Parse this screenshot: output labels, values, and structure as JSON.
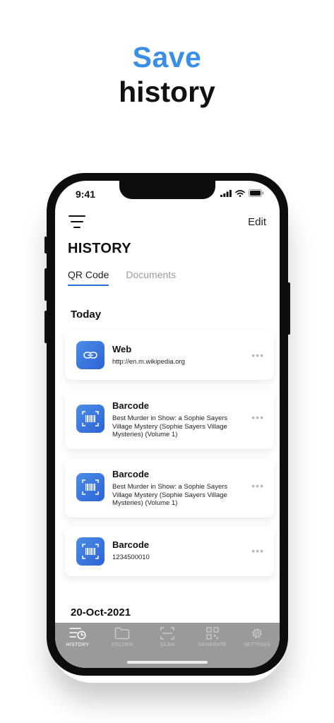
{
  "headline": {
    "accent": "Save",
    "main": "history"
  },
  "status_bar": {
    "time": "9:41"
  },
  "header": {
    "edit_label": "Edit",
    "title": "HISTORY"
  },
  "tabs": [
    {
      "label": "QR Code",
      "active": true
    },
    {
      "label": "Documents",
      "active": false
    }
  ],
  "sections": [
    {
      "title": "Today",
      "items": [
        {
          "type": "Web",
          "icon": "link-icon",
          "subtitle": "http://en.m.wikipedia.org"
        },
        {
          "type": "Barcode",
          "icon": "barcode-icon",
          "subtitle": "Best Murder in Show: a Sophie Sayers Village Mystery (Sophie Sayers Village Mysteries) (Volume 1)"
        },
        {
          "type": "Barcode",
          "icon": "barcode-icon",
          "subtitle": "Best Murder in Show: a Sophie Sayers Village Mystery (Sophie Sayers Village Mysteries) (Volume 1)"
        },
        {
          "type": "Barcode",
          "icon": "barcode-icon",
          "subtitle": "1234500010"
        }
      ]
    },
    {
      "title": "20-Oct-2021",
      "items": []
    }
  ],
  "more_glyph": "•••",
  "bottom_nav": [
    {
      "label": "HISTORY",
      "icon": "history-icon",
      "active": true
    },
    {
      "label": "FOLDER",
      "icon": "folder-icon",
      "active": false
    },
    {
      "label": "SCAN",
      "icon": "scan-icon",
      "active": false
    },
    {
      "label": "GENERATE",
      "icon": "qr-generate-icon",
      "active": false
    },
    {
      "label": "SETTINGS",
      "icon": "gear-icon",
      "active": false
    }
  ],
  "colors": {
    "accent": "#3a8ee6",
    "icon_tile": "#3a74e0",
    "tab_underline": "#2f6fdc",
    "nav_bg": "#9a9a9a"
  }
}
